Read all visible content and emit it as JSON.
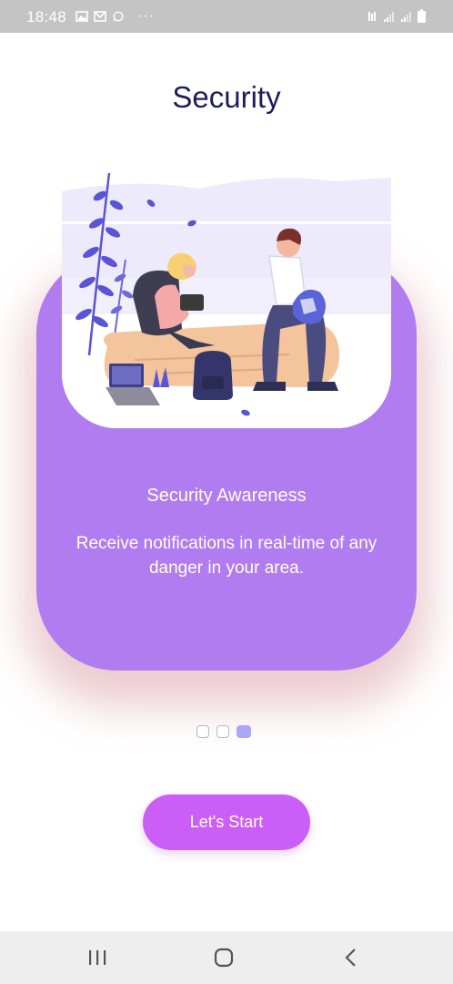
{
  "status_bar": {
    "time": "18:48",
    "left_icons": [
      "image-icon",
      "gmail-icon",
      "whatsapp-icon",
      "more-dots-icon"
    ],
    "right_icons": [
      "vibrate-icon",
      "signal-icon",
      "signal-icon",
      "battery-icon"
    ]
  },
  "page": {
    "title": "Security"
  },
  "slide": {
    "title": "Security Awareness",
    "description": "Receive notifications in real-time of any danger in your area.",
    "illustration": "people-sitting-on-log-illustration"
  },
  "pager": {
    "total": 3,
    "active_index": 3
  },
  "start_button": {
    "label": "Let's Start"
  },
  "nav_bar": {
    "buttons": [
      "recent-apps-icon",
      "home-icon",
      "back-icon"
    ]
  },
  "colors": {
    "status_bar": "#c4c4c4",
    "title": "#1e1d5e",
    "card": "#b07cf0",
    "button": "#cc5ef8",
    "dot_active": "#a9a8f6",
    "nav_bar": "#eeeeee"
  }
}
